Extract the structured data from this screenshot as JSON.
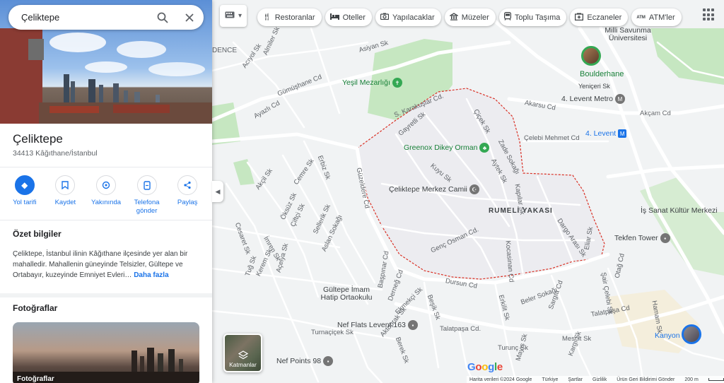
{
  "search": {
    "value": "Çeliktepe"
  },
  "place": {
    "title": "Çeliktepe",
    "address": "34413 Kâğıthane/İstanbul"
  },
  "actions": [
    {
      "label": "Yol tarifi",
      "icon": "directions-icon"
    },
    {
      "label": "Kaydet",
      "icon": "bookmark-icon"
    },
    {
      "label": "Yakınında",
      "icon": "nearby-icon"
    },
    {
      "label": "Telefona gönder",
      "icon": "send-to-phone-icon"
    },
    {
      "label": "Paylaş",
      "icon": "share-icon"
    }
  ],
  "summary": {
    "heading": "Özet bilgiler",
    "text": "Çeliktepe, İstanbul ilinin Kâğıthane ilçesinde yer alan bir mahalledir. Mahallenin güneyinde Telsizler, Gültepe ve Ortabayır, kuzeyinde Emniyet Evleri…",
    "more": "Daha fazla"
  },
  "photos": {
    "heading": "Fotoğraflar",
    "label": "Fotoğraflar"
  },
  "chips": [
    {
      "label": "Restoranlar",
      "icon": "fork-knife-icon"
    },
    {
      "label": "Oteller",
      "icon": "bed-icon"
    },
    {
      "label": "Yapılacaklar",
      "icon": "camera-icon"
    },
    {
      "label": "Müzeler",
      "icon": "museum-icon"
    },
    {
      "label": "Toplu Taşıma",
      "icon": "transit-icon"
    },
    {
      "label": "Eczaneler",
      "icon": "pharmacy-icon"
    },
    {
      "label": "ATM'ler",
      "icon": "atm-icon"
    }
  ],
  "map": {
    "district": "RUMELİ YAKASI",
    "pois": [
      {
        "name": "Yeşil Mezarlığı",
        "kind": "green"
      },
      {
        "name": "Greenox Dikey Orman",
        "kind": "green"
      },
      {
        "name": "Çeliktepe Merkez Camii",
        "kind": "gray"
      },
      {
        "name": "Boulderhane",
        "kind": "green"
      },
      {
        "name": "4. Levent Metro",
        "kind": "gray"
      },
      {
        "name": "4. Levent",
        "kind": "metro"
      },
      {
        "name": "Yeniçeri Sk",
        "kind": "gray"
      },
      {
        "name": "Milli Savunma Üniversitesi",
        "kind": "gray"
      },
      {
        "name": "İş Sanat Kültür Merkezi",
        "kind": "gray"
      },
      {
        "name": "Tekfen Tower",
        "kind": "gray"
      },
      {
        "name": "Gültepe İmam Hatip Ortaokulu",
        "kind": "gray"
      },
      {
        "name": "Nef Flats Levent 163",
        "kind": "gray"
      },
      {
        "name": "Nef Points 98",
        "kind": "gray"
      },
      {
        "name": "Kanyon",
        "kind": "blue"
      }
    ],
    "streets": [
      "S. Karakuşlar Cd.",
      "Güzeldere Cd",
      "Gümüşhane Cd",
      "Akarsu Cd",
      "Akçam Cd",
      "Çelebi Mehmet Cd",
      "Gayretli Sk",
      "Çiçek Sk",
      "Zade Sokağı",
      "Aytek Sk",
      "Kuyu Sk",
      "Kapılar Sk",
      "Genç Osman Cd.",
      "Dursun Cd",
      "Talatpaşa Cd.",
      "Talatpaşa Cd",
      "Dargo Arası Sk",
      "Hamam Sk",
      "Beşik Sk",
      "Asiyan Sk",
      "Ayazlı Cd",
      "Erbiz Sk",
      "Cemre Sk",
      "Akçil Sk",
      "Öksüz Sk",
      "Çiftçi Sk",
      "Sellerik Sk",
      "Aslan Sokağı",
      "Kocasinan Cd",
      "Beler Sokağı",
      "Erkilit Sk",
      "Mescit Sk",
      "Turnaçiçek Sk",
      "Kerem Sk",
      "Tuğ Sk",
      "İmren Sk",
      "Turunç Sk",
      "Açelya Sk",
      "Cesaret Sk",
      "Başpınar Cd",
      "Derneğ Cd",
      "Berek Sk",
      "Mayıs Sk",
      "Otağ Cd",
      "Eliar Sk",
      "Sargıa Cd",
      "Şair Çelebi Sk",
      "Almiler Sk",
      "Acıyol Sk",
      "Aktoprak Sk",
      "Kargı Sk",
      "Ekmekçi Sk"
    ],
    "edge_label": "DENCE"
  },
  "layers": {
    "label": "Katmanlar"
  },
  "google_logo": "Google",
  "footer": {
    "data": "Harita verileri ©2024 Google",
    "links": [
      "Türkiye",
      "Şartlar",
      "Gizlilik",
      "Ürün Geri Bildirimi Gönder"
    ],
    "scale": "200 m"
  },
  "colors": {
    "accent": "#1a73e8",
    "boundary": "#d93025",
    "green": "#c6e7c1"
  }
}
